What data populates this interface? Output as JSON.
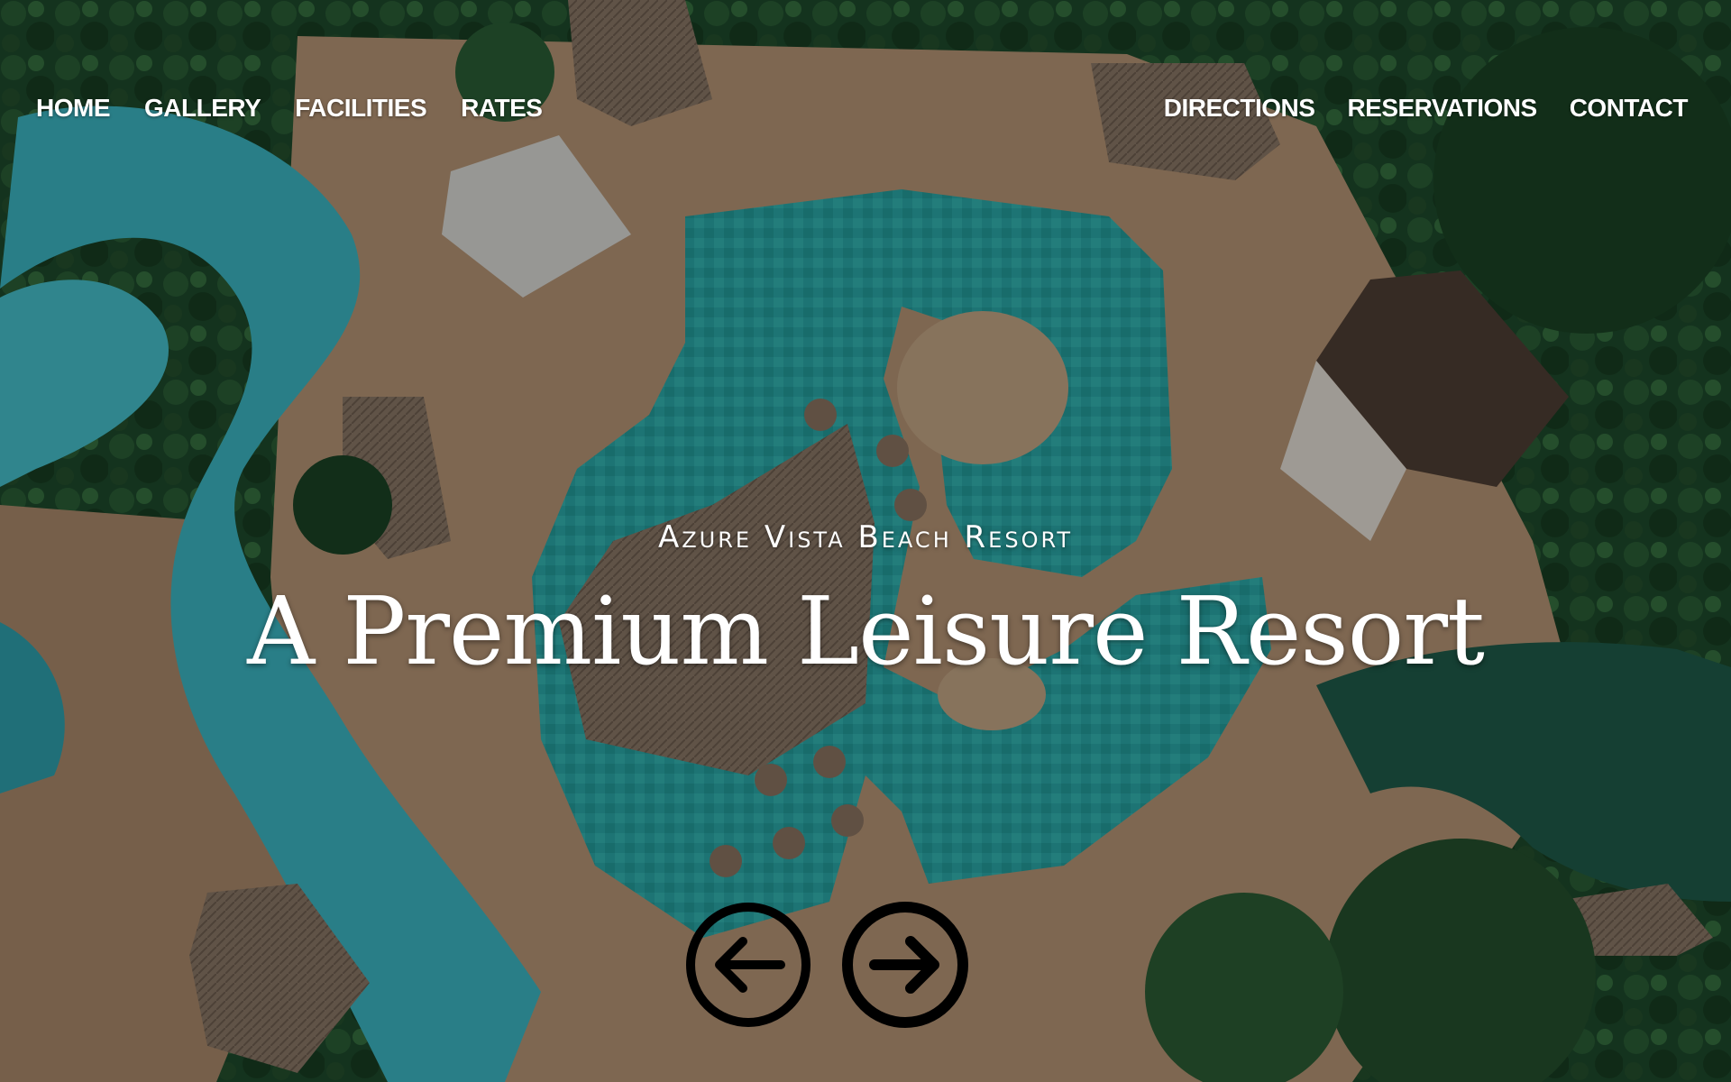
{
  "nav": {
    "left": [
      {
        "label": "HOME"
      },
      {
        "label": "GALLERY"
      },
      {
        "label": "FACILITIES"
      },
      {
        "label": "RATES"
      }
    ],
    "right": [
      {
        "label": "DIRECTIONS"
      },
      {
        "label": "RESERVATIONS"
      },
      {
        "label": "CONTACT"
      }
    ]
  },
  "hero": {
    "subtitle": "Azure Vista Beach Resort",
    "title": "A Premium Leisure Resort",
    "background": "aerial-resort-pool-photo"
  },
  "slider": {
    "prev_icon": "arrow-left-icon",
    "next_icon": "arrow-right-icon"
  },
  "colors": {
    "text": "#ffffff",
    "arrow_stroke": "#000000",
    "pool": "#2fa8a8",
    "foliage": "#1f4a2c",
    "sand": "#b89a78"
  }
}
